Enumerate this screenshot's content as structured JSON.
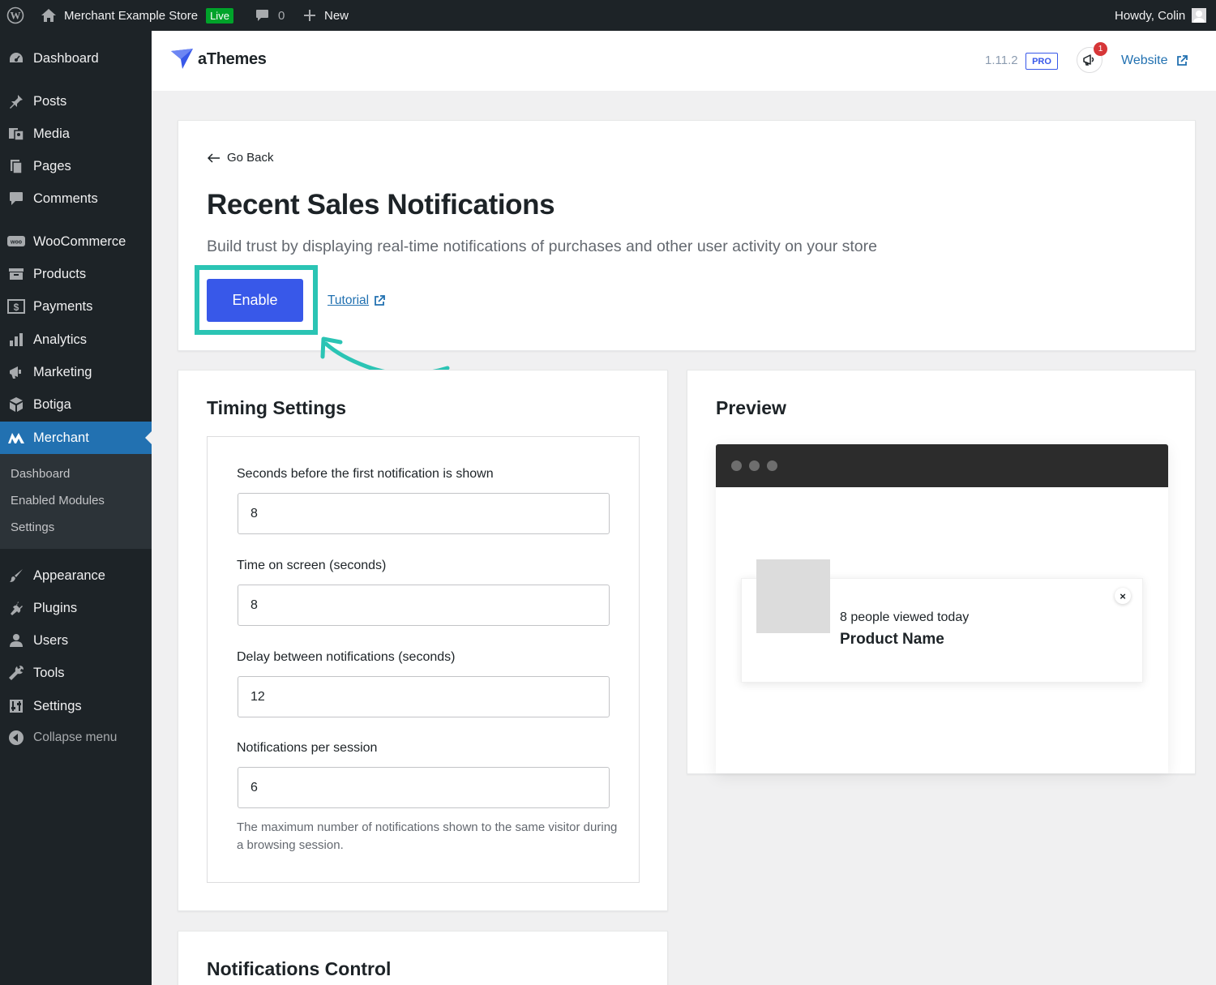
{
  "adminbar": {
    "site_name": "Merchant Example Store",
    "live_badge": "Live",
    "comments_count": "0",
    "new_label": "New",
    "howdy": "Howdy, Colin"
  },
  "sidebar": {
    "items": [
      {
        "label": "Dashboard",
        "icon": "dashboard-icon"
      },
      {
        "label": "Posts",
        "icon": "pin-icon"
      },
      {
        "label": "Media",
        "icon": "media-icon"
      },
      {
        "label": "Pages",
        "icon": "pages-icon"
      },
      {
        "label": "Comments",
        "icon": "comment-icon"
      },
      {
        "label": "WooCommerce",
        "icon": "woo-icon"
      },
      {
        "label": "Products",
        "icon": "archive-icon"
      },
      {
        "label": "Payments",
        "icon": "dollar-icon"
      },
      {
        "label": "Analytics",
        "icon": "bar-chart-icon"
      },
      {
        "label": "Marketing",
        "icon": "megaphone-icon"
      },
      {
        "label": "Botiga",
        "icon": "botiga-icon"
      },
      {
        "label": "Merchant",
        "icon": "merchant-icon"
      },
      {
        "label": "Appearance",
        "icon": "brush-icon"
      },
      {
        "label": "Plugins",
        "icon": "plug-icon"
      },
      {
        "label": "Users",
        "icon": "user-icon"
      },
      {
        "label": "Tools",
        "icon": "wrench-icon"
      },
      {
        "label": "Settings",
        "icon": "settings-icon"
      }
    ],
    "submenu": [
      "Dashboard",
      "Enabled Modules",
      "Settings"
    ],
    "collapse_label": "Collapse menu"
  },
  "header": {
    "logo_text": "aThemes",
    "version": "1.11.2",
    "pro_badge": "PRO",
    "notification_count": "1",
    "website_label": "Website"
  },
  "module": {
    "go_back": "Go Back",
    "title": "Recent Sales Notifications",
    "description": "Build trust by displaying real-time notifications of purchases and other user activity on your store",
    "enable_label": "Enable",
    "tutorial_label": "Tutorial"
  },
  "timing": {
    "title": "Timing Settings",
    "fields": [
      {
        "label": "Seconds before the first notification is shown",
        "value": "8"
      },
      {
        "label": "Time on screen (seconds)",
        "value": "8"
      },
      {
        "label": "Delay between notifications (seconds)",
        "value": "12"
      },
      {
        "label": "Notifications per session",
        "value": "6"
      }
    ],
    "help_text": "The maximum number of notifications shown to the same visitor during a browsing session."
  },
  "preview": {
    "title": "Preview",
    "notification_text": "8 people viewed today",
    "product_name": "Product Name",
    "close_label": "×"
  },
  "control": {
    "title": "Notifications Control"
  },
  "colors": {
    "accent": "#3858e9",
    "highlight": "#2bc4b4",
    "admin_bg": "#1d2327",
    "active_menu": "#2271b1"
  }
}
